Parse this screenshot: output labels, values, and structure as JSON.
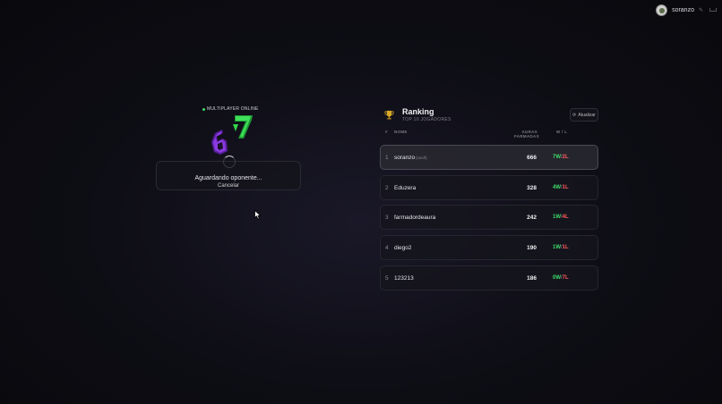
{
  "user": {
    "name": "soranzo"
  },
  "matchmaking": {
    "mode_label": "MULTIPLAYER ONLINE",
    "status": "Aguardando oponente...",
    "cancel_label": "Cancelar",
    "logo_text": "67"
  },
  "ranking": {
    "title": "Ranking",
    "subtitle": "TOP 10 JOGADORES",
    "refresh_label": "Atualizar",
    "columns": {
      "pos": "#",
      "name": "NOME",
      "aura": "AURAS FARMADAS",
      "wl": "W / L"
    },
    "rows": [
      {
        "pos": "1",
        "name": "soranzo",
        "you": "(você)",
        "aura": "666",
        "w": "7W",
        "l": "2L"
      },
      {
        "pos": "2",
        "name": "Eduzera",
        "you": "",
        "aura": "328",
        "w": "4W",
        "l": "1L"
      },
      {
        "pos": "3",
        "name": "farmadordeaura",
        "you": "",
        "aura": "242",
        "w": "1W",
        "l": "4L"
      },
      {
        "pos": "4",
        "name": "diego2",
        "you": "",
        "aura": "190",
        "w": "1W",
        "l": "1L"
      },
      {
        "pos": "5",
        "name": "123213",
        "you": "",
        "aura": "186",
        "w": "0W",
        "l": "7L"
      }
    ]
  },
  "colors": {
    "win": "#3ddc6a",
    "loss": "#ff5a5a",
    "logo_six": "#7b2fd0",
    "logo_seven": "#2fd84a"
  }
}
